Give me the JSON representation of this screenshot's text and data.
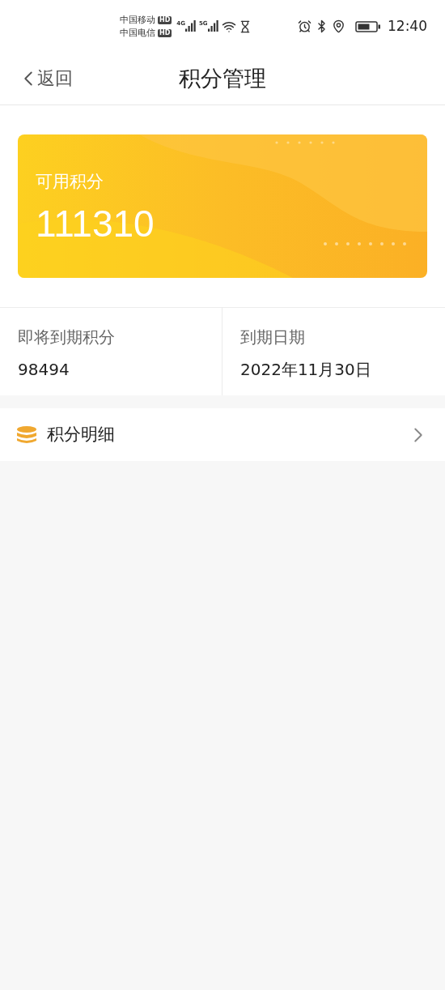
{
  "status_bar": {
    "carriers": [
      {
        "name": "中国移动",
        "badge": "HD"
      },
      {
        "name": "中国电信",
        "badge": "HD"
      }
    ],
    "signals": [
      "4G",
      "5G"
    ],
    "time": "12:40"
  },
  "nav": {
    "back": "返回",
    "title": "积分管理"
  },
  "points_card": {
    "label": "可用积分",
    "value": "111310"
  },
  "info": [
    {
      "label": "即将到期积分",
      "value": "98494"
    },
    {
      "label": "到期日期",
      "value": "2022年11月30日"
    }
  ],
  "menu": [
    {
      "label": "积分明细"
    }
  ]
}
